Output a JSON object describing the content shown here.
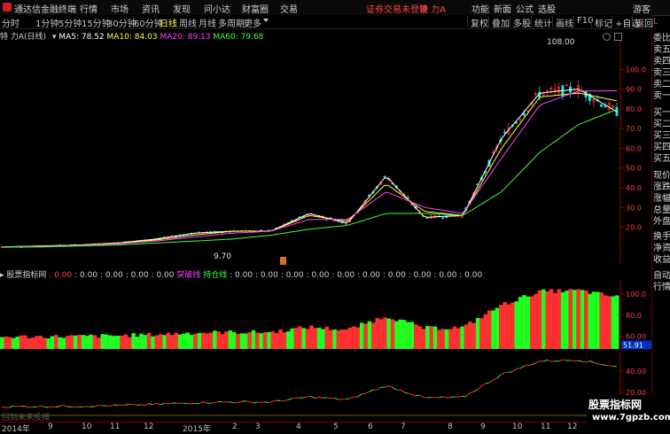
{
  "titlebar": {
    "app_name": "通达信金融终端",
    "menus": [
      "行情",
      "市场",
      "资讯",
      "发现",
      "问小达",
      "财富圈",
      "交易"
    ],
    "login_status": "证券交易未登录",
    "stock_name": "特 力A",
    "right_menus": [
      "功能",
      "新面",
      "公式",
      "选股"
    ],
    "guest": "游客"
  },
  "periods": [
    "分时",
    "1分钟",
    "5分钟",
    "15分钟",
    "30分钟",
    "60分钟",
    "日线",
    "周线",
    "月线",
    "多周期",
    "更多"
  ],
  "active_period": "日线",
  "toolbar": [
    "复权",
    "叠加",
    "多股",
    "统计",
    "画线",
    "F10",
    "标记",
    "+自选",
    "返回"
  ],
  "chart_header": {
    "stock_label": "特 力A",
    "period_label": "(日线)",
    "ma5": "MA5: 78.52",
    "ma10": "MA10: 84.03",
    "ma20": "MA20: 89.13",
    "ma60": "MA60: 79.68"
  },
  "price_axis": [
    "100.0",
    "90.0",
    "80.0",
    "70.0",
    "60.0",
    "50.0",
    "40.0",
    "30.0",
    "20.0"
  ],
  "high_label": "108.00",
  "low_label": "9.70",
  "indicator_header": {
    "name": "股票指标网",
    "values": [
      ": 0.00",
      ": 0.00",
      ": 0.00",
      ": 0.00",
      ": 0.00"
    ],
    "breakout": "突破线",
    "holding": "持仓线",
    "tail": ": 0.00 : 0.00 : 0.00 : 0.00 : 0.00 : 0.00 : 0.00 : 0.00 : 0.00 : 0.00"
  },
  "vol_axis": [
    "100.0",
    "80.0",
    "60.00"
  ],
  "vol_current": "51.91",
  "macd_axis": [
    "40.00",
    "20.00"
  ],
  "bottom_text": "回到未来投搏",
  "date_labels": [
    "2014年",
    "9",
    "10",
    "11",
    "12",
    "2015年",
    "2",
    "3",
    "4",
    "5",
    "6",
    "7",
    "8",
    "9",
    "10",
    "11",
    "12"
  ],
  "right_panel": {
    "red_letter": "L",
    "items": [
      "委比",
      "卖五",
      "卖四",
      "卖三",
      "卖二",
      "卖一",
      "买一",
      "买二",
      "买三",
      "买四",
      "买五",
      "现价",
      "涨跌",
      "涨幅",
      "总量",
      "外盘",
      "换手",
      "净资",
      "收益"
    ],
    "bottom_items": [
      "自动",
      "行情"
    ]
  },
  "watermark": {
    "line1": "股票指标网",
    "line2": "www.7gpzb.com"
  },
  "colors": {
    "up": "#ff3030",
    "down": "#20ff20",
    "ma5": "#ffffff",
    "ma10": "#ffff40",
    "ma20": "#ff40ff",
    "ma60": "#40ff40",
    "axis": "#a00000"
  },
  "chart_data": {
    "type": "line",
    "title": "",
    "ylim": [
      5,
      110
    ],
    "x": [
      "2014-08",
      "2014-09",
      "2014-10",
      "2014-11",
      "2014-12",
      "2015-01",
      "2015-02",
      "2015-03",
      "2015-04",
      "2015-05",
      "2015-06",
      "2015-07",
      "2015-08",
      "2015-09",
      "2015-10",
      "2015-11",
      "2015-12"
    ],
    "series": [
      {
        "name": "MA5",
        "values": [
          10,
          10.5,
          11,
          12,
          14,
          17,
          18,
          18,
          27,
          22,
          46,
          25,
          26,
          65,
          88,
          90,
          78.52
        ]
      },
      {
        "name": "MA10",
        "values": [
          10,
          10.5,
          11,
          12,
          13.5,
          16,
          18,
          18,
          26,
          23,
          42,
          28,
          26,
          60,
          86,
          88,
          84.03
        ]
      },
      {
        "name": "MA20",
        "values": [
          10,
          10.3,
          10.8,
          11.5,
          13,
          15,
          17,
          18,
          24,
          24,
          38,
          30,
          27,
          55,
          82,
          89,
          89.13
        ]
      },
      {
        "name": "MA60",
        "values": [
          10,
          10,
          10.5,
          11,
          12,
          13,
          14,
          16,
          19,
          21,
          27,
          27,
          26,
          38,
          58,
          72,
          79.68
        ]
      }
    ]
  }
}
